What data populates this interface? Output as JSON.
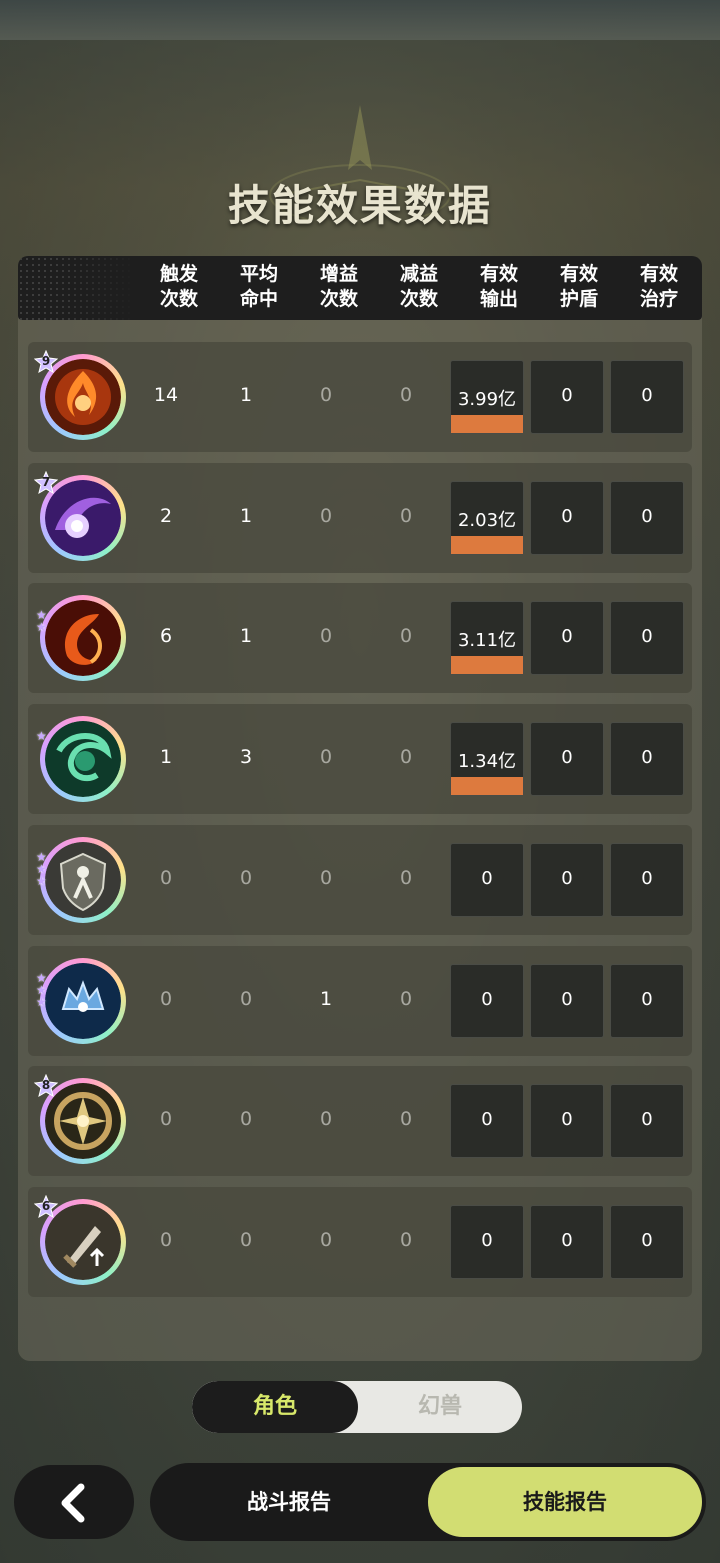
{
  "title": "技能效果数据",
  "columns": [
    "触发\n次数",
    "平均\n命中",
    "增益\n次数",
    "减益\n次数",
    "有效\n输出",
    "有效\n护盾",
    "有效\n治疗"
  ],
  "rows": [
    {
      "icon": "fire-swirl-skill-icon",
      "level": "9",
      "stars": 0,
      "trigger": "14",
      "hit": "1",
      "buff": "0",
      "debuff": "0",
      "output": "3.99亿",
      "output_ratio": 1.0,
      "shield": "0",
      "heal": "0"
    },
    {
      "icon": "purple-orb-skill-icon",
      "level": "7",
      "stars": 0,
      "trigger": "2",
      "hit": "1",
      "buff": "0",
      "debuff": "0",
      "output": "2.03亿",
      "output_ratio": 1.0,
      "shield": "0",
      "heal": "0"
    },
    {
      "icon": "flame-crescent-skill-icon",
      "level": "",
      "stars": 2,
      "trigger": "6",
      "hit": "1",
      "buff": "0",
      "debuff": "0",
      "output": "3.11亿",
      "output_ratio": 1.0,
      "shield": "0",
      "heal": "0"
    },
    {
      "icon": "green-vortex-skill-icon",
      "level": "",
      "stars": 1,
      "trigger": "1",
      "hit": "3",
      "buff": "0",
      "debuff": "0",
      "output": "1.34亿",
      "output_ratio": 1.0,
      "shield": "0",
      "heal": "0"
    },
    {
      "icon": "guardian-shield-skill-icon",
      "level": "",
      "stars": 3,
      "trigger": "0",
      "hit": "0",
      "buff": "0",
      "debuff": "0",
      "output": "0",
      "output_ratio": 0,
      "shield": "0",
      "heal": "0"
    },
    {
      "icon": "crystal-crown-skill-icon",
      "level": "",
      "stars": 3,
      "trigger": "0",
      "hit": "0",
      "buff": "1",
      "debuff": "0",
      "output": "0",
      "output_ratio": 0,
      "shield": "0",
      "heal": "0"
    },
    {
      "icon": "golden-aperture-skill-icon",
      "level": "8",
      "stars": 0,
      "trigger": "0",
      "hit": "0",
      "buff": "0",
      "debuff": "0",
      "output": "0",
      "output_ratio": 0,
      "shield": "0",
      "heal": "0"
    },
    {
      "icon": "sword-upgrade-skill-icon",
      "level": "6",
      "stars": 0,
      "trigger": "0",
      "hit": "0",
      "buff": "0",
      "debuff": "0",
      "output": "0",
      "output_ratio": 0,
      "shield": "0",
      "heal": "0"
    }
  ],
  "toggle": {
    "active": "角色",
    "inactive": "幻兽"
  },
  "nav": {
    "back_icon": "chevron-left-icon",
    "battle_report": "战斗报告",
    "skill_report": "技能报告"
  },
  "colors": {
    "bar": "#dd7a3e",
    "accent": "#d2dd72",
    "active_text": "#d8e86a"
  }
}
